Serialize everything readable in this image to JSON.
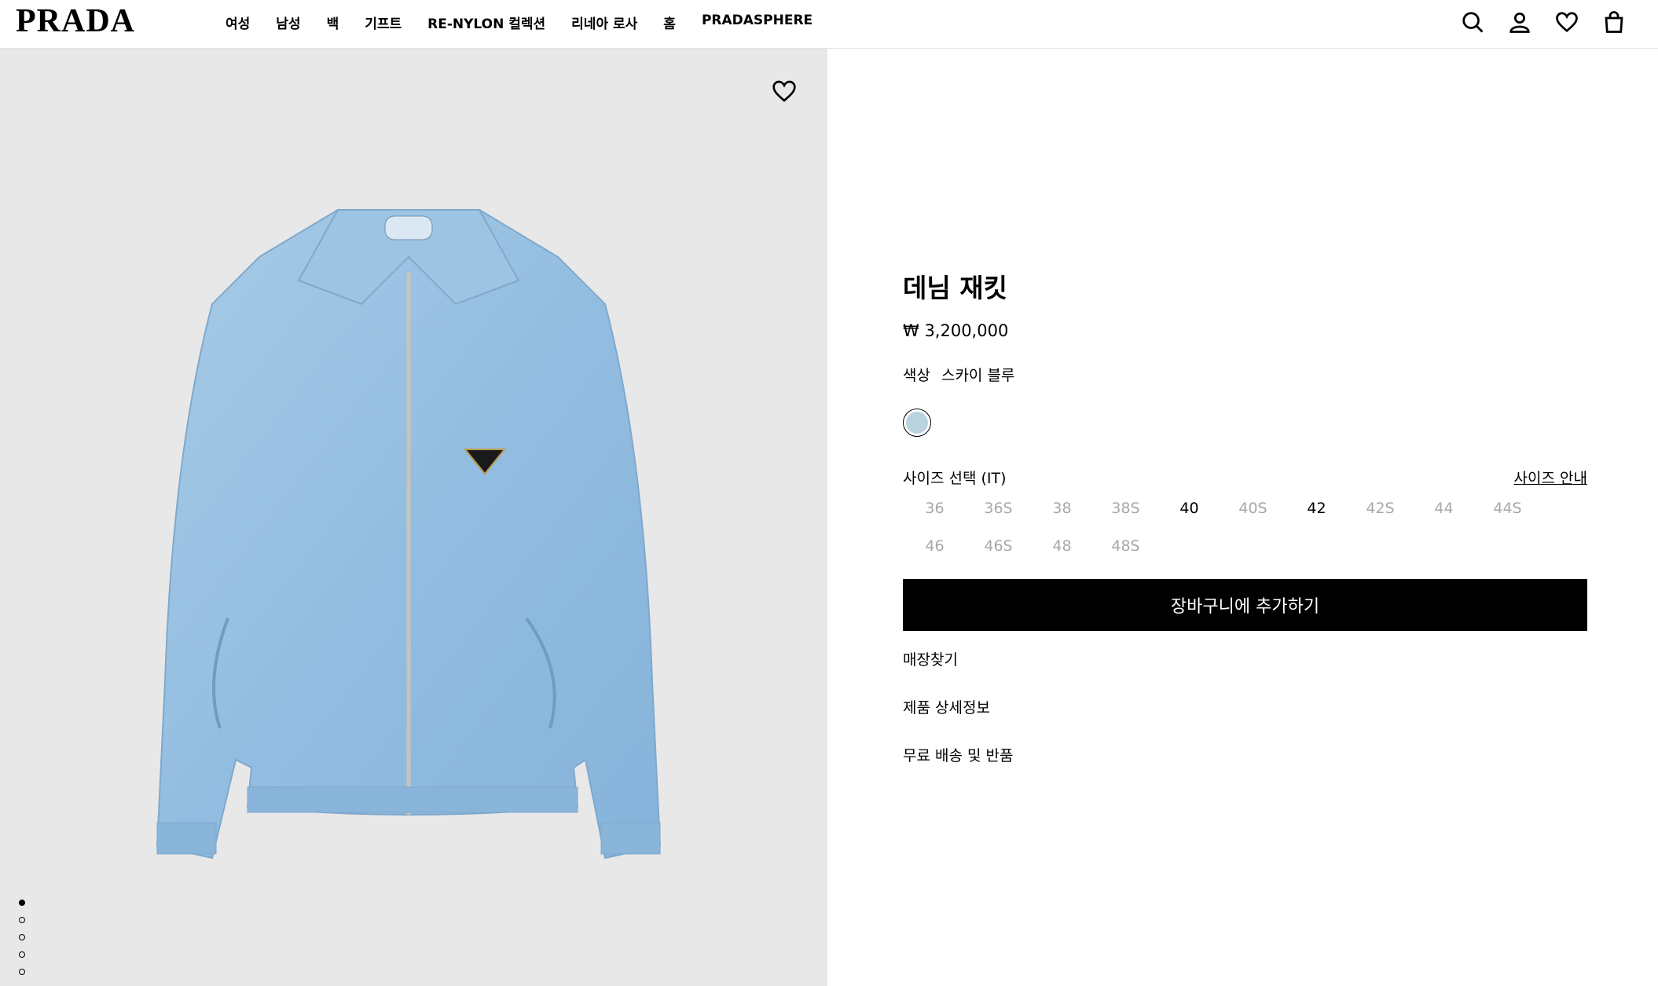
{
  "header": {
    "logo": "PRADA",
    "nav": [
      "여성",
      "남성",
      "백",
      "기프트",
      "RE-NYLON 컬렉션",
      "리네아 로사",
      "홈",
      "PRADASPHERE"
    ],
    "icons": [
      "search-icon",
      "account-icon",
      "heart-icon",
      "bag-icon"
    ]
  },
  "product": {
    "title": "데님 재킷",
    "price": "₩ 3,200,000",
    "color_label": "색상",
    "color_value": "스카이 블루",
    "swatch_color": "#b9d3df",
    "size_label": "사이즈 선택 (IT)",
    "size_guide": "사이즈 안내",
    "sizes": [
      {
        "label": "36",
        "available": false
      },
      {
        "label": "36S",
        "available": false
      },
      {
        "label": "38",
        "available": false
      },
      {
        "label": "38S",
        "available": false
      },
      {
        "label": "40",
        "available": true
      },
      {
        "label": "40S",
        "available": false
      },
      {
        "label": "42",
        "available": true
      },
      {
        "label": "42S",
        "available": false
      },
      {
        "label": "44",
        "available": false
      },
      {
        "label": "44S",
        "available": false
      },
      {
        "label": "46",
        "available": false
      },
      {
        "label": "46S",
        "available": false
      },
      {
        "label": "48",
        "available": false
      },
      {
        "label": "48S",
        "available": false
      }
    ],
    "add_to_cart": "장바구니에 추가하기",
    "links": [
      "매장찾기",
      "제품 상세정보",
      "무료 배송 및 반품"
    ]
  },
  "gallery": {
    "image_count": 5,
    "active_index": 0,
    "background": "#e8e8e9",
    "jacket_color": "#9dc3e3"
  }
}
